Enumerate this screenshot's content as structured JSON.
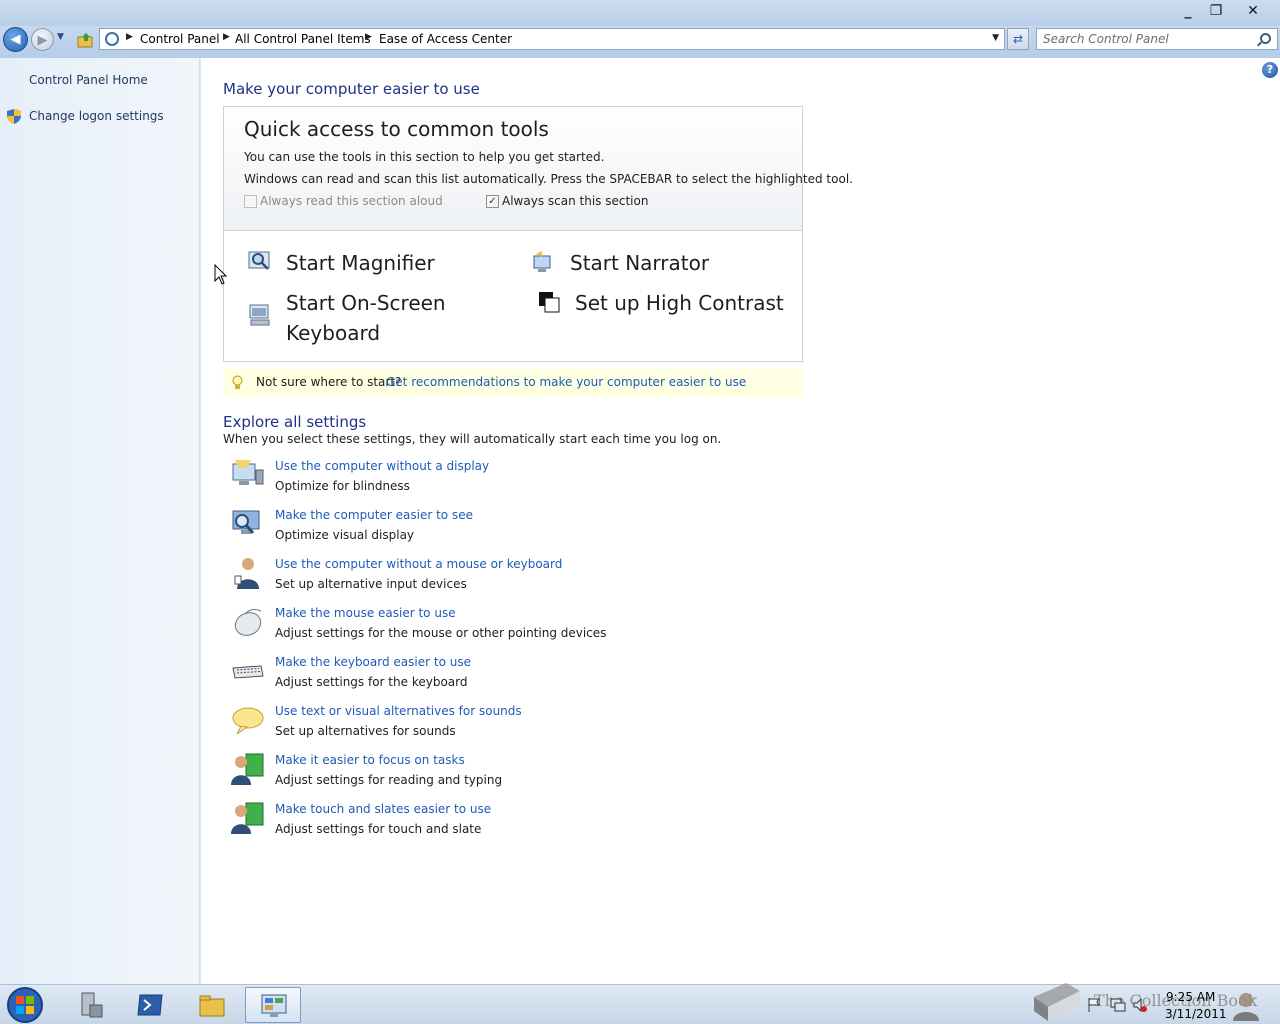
{
  "window": {
    "minimize": "_",
    "restore": "❐",
    "close": "✕"
  },
  "address": {
    "breadcrumbs": [
      "Control Panel",
      "All Control Panel Items",
      "Ease of Access Center"
    ],
    "search_placeholder": "Search Control Panel"
  },
  "sidebar": {
    "items": [
      {
        "label": "Control Panel Home"
      },
      {
        "label": "Change logon settings"
      }
    ]
  },
  "main": {
    "title": "Make your computer easier to use",
    "quick": {
      "title": "Quick access to common tools",
      "line1": "You can use the tools in this section to help you get started.",
      "line2": "Windows can read and scan this list automatically.  Press the SPACEBAR to select the highlighted tool.",
      "read_aloud": {
        "label": "Always read this section aloud",
        "checked": false,
        "disabled": true
      },
      "scan": {
        "label": "Always scan this section",
        "checked": true
      },
      "tools": {
        "magnifier": "Start Magnifier",
        "narrator": "Start Narrator",
        "osk_line1": "Start On-Screen",
        "osk_line2": "Keyboard",
        "contrast": "Set up High Contrast"
      }
    },
    "hint": {
      "text": "Not sure where to start?",
      "link": "Get recommendations to make your computer easier to use"
    },
    "explore": {
      "title": "Explore all settings",
      "desc": "When you select these settings, they will automatically start each time you log on.",
      "settings": [
        {
          "link": "Use the computer without a display",
          "desc": "Optimize for blindness",
          "icon": "monitor-speaker-icon"
        },
        {
          "link": "Make the computer easier to see",
          "desc": "Optimize visual display",
          "icon": "monitor-magnifier-icon"
        },
        {
          "link": "Use the computer without a mouse or keyboard",
          "desc": "Set up alternative input devices",
          "icon": "person-icon"
        },
        {
          "link": "Make the mouse easier to use",
          "desc": "Adjust settings for the mouse or other pointing devices",
          "icon": "mouse-icon"
        },
        {
          "link": "Make the keyboard easier to use",
          "desc": "Adjust settings for the keyboard",
          "icon": "keyboard-icon"
        },
        {
          "link": "Use text or visual alternatives for sounds",
          "desc": "Set up alternatives for sounds",
          "icon": "speech-bubble-icon"
        },
        {
          "link": "Make it easier to focus on tasks",
          "desc": "Adjust settings for reading and typing",
          "icon": "person-board-icon"
        },
        {
          "link": "Make touch and slates easier to use",
          "desc": "Adjust settings for touch and slate",
          "icon": "person-board-icon"
        }
      ]
    }
  },
  "taskbar": {
    "watermark": "The Collection Book",
    "time": "9:25 AM",
    "date": "3/11/2011"
  },
  "colors": {
    "link": "#1e5bb8",
    "heading": "#1e3287",
    "hint_bg": "#ffffe1"
  }
}
